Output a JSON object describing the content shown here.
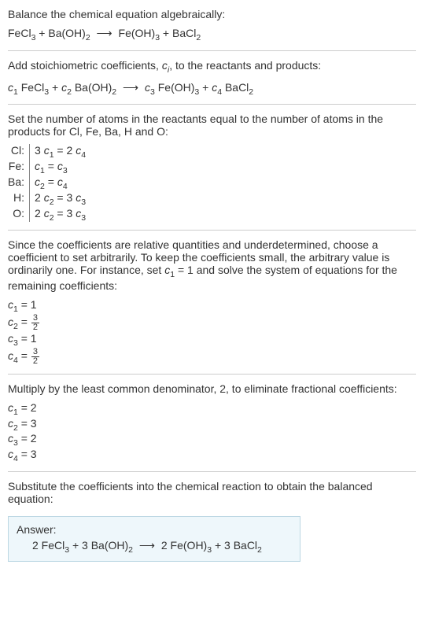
{
  "line1": "Balance the chemical equation algebraically:",
  "eq1": {
    "pre": "FeCl",
    "s1": "3",
    "mid1": " + Ba(OH)",
    "s2": "2",
    "arrow": "⟶",
    "post": " Fe(OH)",
    "s3": "3",
    "mid2": " + BaCl",
    "s4": "2"
  },
  "line2a": "Add stoichiometric coefficients, ",
  "line2b": ", to the reactants and products:",
  "ci_c": "c",
  "ci_i": "i",
  "eq2": {
    "c1c": "c",
    "c1n": "1",
    "t1": " FeCl",
    "s1": "3",
    "plus1": " + ",
    "c2c": "c",
    "c2n": "2",
    "t2": " Ba(OH)",
    "s2": "2",
    "arrow": "⟶",
    "c3c": "c",
    "c3n": "3",
    "t3": " Fe(OH)",
    "s3": "3",
    "plus2": " + ",
    "c4c": "c",
    "c4n": "4",
    "t4": " BaCl",
    "s4": "2"
  },
  "line3": "Set the number of atoms in the reactants equal to the number of atoms in the products for Cl, Fe, Ba, H and O:",
  "atoms": {
    "r1l": "Cl:",
    "r1c3": "3 ",
    "r1c": "c",
    "r1s1": "1",
    "r1eq": " = 2 ",
    "r1c2": "c",
    "r1s2": "4",
    "r2l": "Fe:",
    "r2c": "c",
    "r2s1": "1",
    "r2eq": " = ",
    "r2c2": "c",
    "r2s2": "3",
    "r3l": "Ba:",
    "r3c": "c",
    "r3s1": "2",
    "r3eq": " = ",
    "r3c2": "c",
    "r3s2": "4",
    "r4l": "H:",
    "r4c2a": "2 ",
    "r4c": "c",
    "r4s1": "2",
    "r4eq": " = 3 ",
    "r4c2": "c",
    "r4s2": "3",
    "r5l": "O:",
    "r5c2a": "2 ",
    "r5c": "c",
    "r5s1": "2",
    "r5eq": " = 3 ",
    "r5c2": "c",
    "r5s2": "3"
  },
  "line4a": "Since the coefficients are relative quantities and underdetermined, choose a coefficient to set arbitrarily. To keep the coefficients small, the arbitrary value is ordinarily one. For instance, set ",
  "line4c": "c",
  "line4s": "1",
  "line4eq": " = 1",
  "line4b": " and solve the system of equations for the remaining coefficients:",
  "coef1": {
    "c": "c",
    "n": "1",
    "eq": " = 1"
  },
  "coef2": {
    "c": "c",
    "n": "2",
    "eq": " = ",
    "num": "3",
    "den": "2"
  },
  "coef3": {
    "c": "c",
    "n": "3",
    "eq": " = 1"
  },
  "coef4": {
    "c": "c",
    "n": "4",
    "eq": " = ",
    "num": "3",
    "den": "2"
  },
  "line5": "Multiply by the least common denominator, 2, to eliminate fractional coefficients:",
  "mcoef1": {
    "c": "c",
    "n": "1",
    "eq": " = 2"
  },
  "mcoef2": {
    "c": "c",
    "n": "2",
    "eq": " = 3"
  },
  "mcoef3": {
    "c": "c",
    "n": "3",
    "eq": " = 2"
  },
  "mcoef4": {
    "c": "c",
    "n": "4",
    "eq": " = 3"
  },
  "line6": "Substitute the coefficients into the chemical reaction to obtain the balanced equation:",
  "answerLabel": "Answer:",
  "ans": {
    "t1": "2 FeCl",
    "s1": "3",
    "p1": " + 3 Ba(OH)",
    "s2": "2",
    "arrow": "⟶",
    "t2": " 2 Fe(OH)",
    "s3": "3",
    "p2": " + 3 BaCl",
    "s4": "2"
  }
}
